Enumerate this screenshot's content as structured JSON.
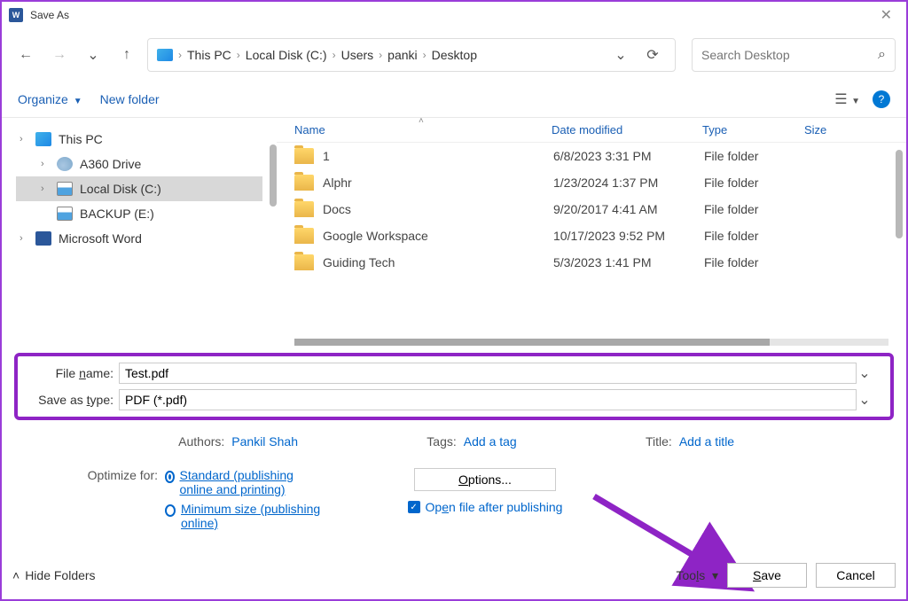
{
  "title": "Save As",
  "breadcrumbs": [
    "This PC",
    "Local Disk (C:)",
    "Users",
    "panki",
    "Desktop"
  ],
  "search_placeholder": "Search Desktop",
  "toolbar": {
    "organize": "Organize",
    "new_folder": "New folder"
  },
  "tree": [
    {
      "label": "This PC",
      "icon": "pc",
      "depth": 0,
      "expandable": true,
      "sel": false
    },
    {
      "label": "A360 Drive",
      "icon": "cloud",
      "depth": 1,
      "expandable": true,
      "sel": false
    },
    {
      "label": "Local Disk (C:)",
      "icon": "disk",
      "depth": 1,
      "expandable": true,
      "sel": true
    },
    {
      "label": "BACKUP (E:)",
      "icon": "disk",
      "depth": 1,
      "expandable": false,
      "sel": false
    },
    {
      "label": "Microsoft Word",
      "icon": "word",
      "depth": 0,
      "expandable": true,
      "sel": false
    }
  ],
  "columns": {
    "name": "Name",
    "date": "Date modified",
    "type": "Type",
    "size": "Size"
  },
  "files": [
    {
      "name": "1",
      "date": "6/8/2023 3:31 PM",
      "type": "File folder"
    },
    {
      "name": "Alphr",
      "date": "1/23/2024 1:37 PM",
      "type": "File folder"
    },
    {
      "name": "Docs",
      "date": "9/20/2017 4:41 AM",
      "type": "File folder"
    },
    {
      "name": "Google Workspace",
      "date": "10/17/2023 9:52 PM",
      "type": "File folder"
    },
    {
      "name": "Guiding Tech",
      "date": "5/3/2023 1:41 PM",
      "type": "File folder"
    }
  ],
  "file_name_label": "File name:",
  "file_name": "Test.pdf",
  "save_type_label": "Save as type:",
  "save_type": "PDF (*.pdf)",
  "authors_label": "Authors:",
  "authors": "Pankil Shah",
  "tags_label": "Tags:",
  "tags": "Add a tag",
  "title_label": "Title:",
  "title_value": "Add a title",
  "optimize_label": "Optimize for:",
  "opt_standard": "Standard (publishing online and printing)",
  "opt_minimum": "Minimum size (publishing online)",
  "options_btn": "Options...",
  "open_after": "Open file after publishing",
  "hide_folders": "Hide Folders",
  "tools": "Tools",
  "save": "Save",
  "cancel": "Cancel"
}
